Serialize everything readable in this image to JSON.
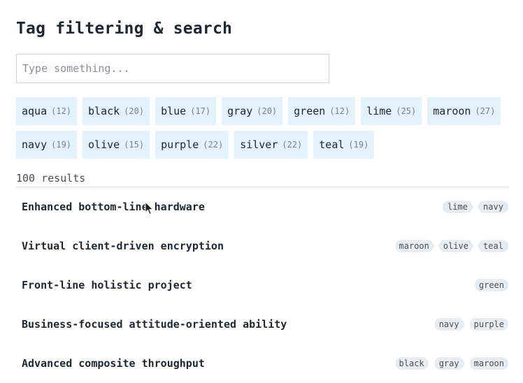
{
  "page": {
    "title": "Tag filtering & search"
  },
  "search": {
    "placeholder": "Type something...",
    "value": ""
  },
  "tags": [
    {
      "name": "aqua",
      "count": "(12)"
    },
    {
      "name": "black",
      "count": "(20)"
    },
    {
      "name": "blue",
      "count": "(17)"
    },
    {
      "name": "gray",
      "count": "(20)"
    },
    {
      "name": "green",
      "count": "(12)"
    },
    {
      "name": "lime",
      "count": "(25)"
    },
    {
      "name": "maroon",
      "count": "(27)"
    },
    {
      "name": "navy",
      "count": "(19)"
    },
    {
      "name": "olive",
      "count": "(15)"
    },
    {
      "name": "purple",
      "count": "(22)"
    },
    {
      "name": "silver",
      "count": "(22)"
    },
    {
      "name": "teal",
      "count": "(19)"
    }
  ],
  "results": {
    "count_label": "100 results",
    "items": [
      {
        "title": "Enhanced bottom-line hardware",
        "tags": [
          "lime",
          "navy"
        ]
      },
      {
        "title": "Virtual client-driven encryption",
        "tags": [
          "maroon",
          "olive",
          "teal"
        ]
      },
      {
        "title": "Front-line holistic project",
        "tags": [
          "green"
        ]
      },
      {
        "title": "Business-focused attitude-oriented ability",
        "tags": [
          "navy",
          "purple"
        ]
      },
      {
        "title": "Advanced composite throughput",
        "tags": [
          "black",
          "gray",
          "maroon"
        ]
      }
    ]
  },
  "colors": {
    "tag_bg": "#e3f2fd",
    "chip_bg": "#e8edf2",
    "text": "#1f2633",
    "muted": "#7b818a"
  }
}
